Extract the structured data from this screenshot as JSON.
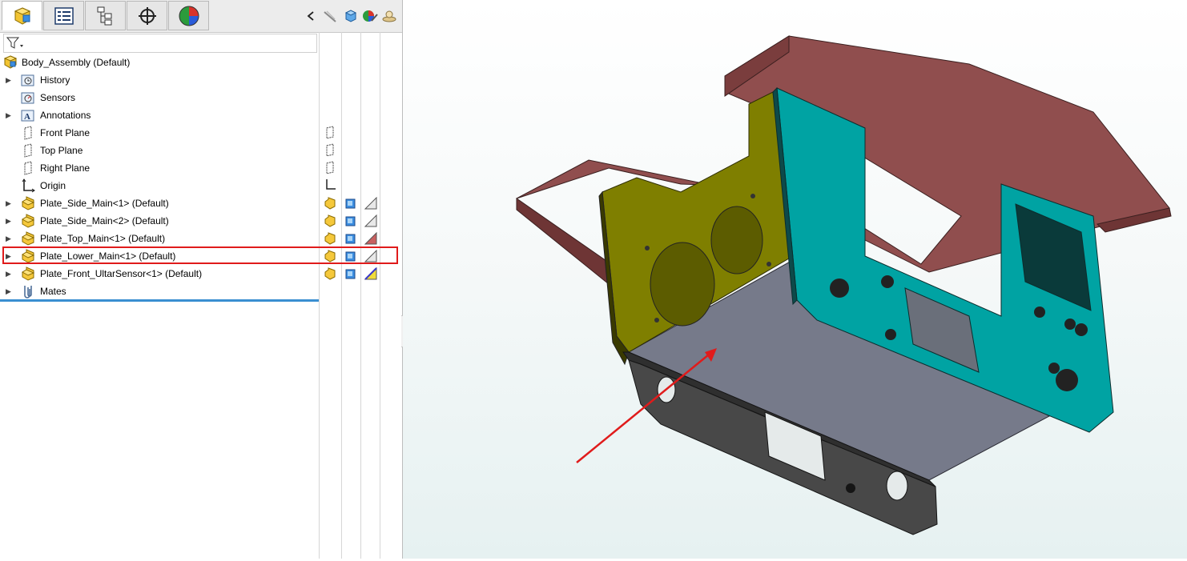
{
  "tabs": [
    {
      "name": "featuremanager-tab",
      "icon": "feature-manager-icon",
      "active": true
    },
    {
      "name": "propertymanager-tab",
      "icon": "property-manager-icon",
      "active": false
    },
    {
      "name": "configurationmanager-tab",
      "icon": "configuration-manager-icon",
      "active": false
    },
    {
      "name": "dimxpert-tab",
      "icon": "dimxpert-icon",
      "active": false
    },
    {
      "name": "display-manager-tab",
      "icon": "display-manager-icon",
      "active": false
    }
  ],
  "toolbar_icons": [
    "collapse-chevron-icon",
    "hide-show-icon",
    "view-cube-icon",
    "appearance-icon",
    "scene-icon"
  ],
  "tree": {
    "root": "Body_Assembly  (Default)",
    "items": [
      {
        "label": "History",
        "icon": "history-icon",
        "expandable": true
      },
      {
        "label": "Sensors",
        "icon": "sensors-icon",
        "expandable": false
      },
      {
        "label": "Annotations",
        "icon": "annotations-icon",
        "expandable": true
      },
      {
        "label": "Front Plane",
        "icon": "plane-icon",
        "expandable": false
      },
      {
        "label": "Top Plane",
        "icon": "plane-icon",
        "expandable": false
      },
      {
        "label": "Right Plane",
        "icon": "plane-icon",
        "expandable": false
      },
      {
        "label": "Origin",
        "icon": "origin-icon",
        "expandable": false
      },
      {
        "label": "Plate_Side_Main<1> (Default)",
        "icon": "part-icon",
        "expandable": true
      },
      {
        "label": "Plate_Side_Main<2> (Default)",
        "icon": "part-icon",
        "expandable": true
      },
      {
        "label": "Plate_Top_Main<1> (Default)",
        "icon": "part-icon",
        "expandable": true
      },
      {
        "label": "Plate_Lower_Main<1> (Default)",
        "icon": "part-icon",
        "expandable": true,
        "highlighted": true
      },
      {
        "label": "Plate_Front_UltarSensor<1> (Default)",
        "icon": "part-icon",
        "expandable": true
      },
      {
        "label": "Mates",
        "icon": "mates-icon",
        "expandable": true
      }
    ]
  },
  "colors": {
    "highlight_box": "#e01b1b",
    "top_plate": "#904e4e",
    "side_plate_teal": "#00a3a3",
    "side_plate_olive": "#7f7f00",
    "lower_plate": "#767a8a",
    "front_plate_dark": "#4a4a4a",
    "arrow": "#e01b1b"
  }
}
